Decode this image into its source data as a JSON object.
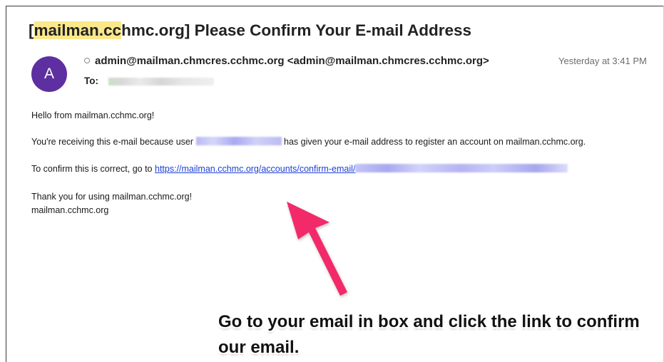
{
  "email": {
    "subject_highlight": "mailman.cc",
    "subject_prefix": "[",
    "subject_rest": "hmc.org] Please Confirm Your E-mail Address",
    "avatar_initial": "A",
    "from": "admin@mailman.chmcres.cchmc.org <admin@mailman.chmcres.cchmc.org>",
    "date": "Yesterday at 3:41 PM",
    "to_label": "To:",
    "body": {
      "greeting": "Hello from mailman.cchmc.org!",
      "line2_before": "You're receiving this e-mail because user",
      "line2_after": "has given your e-mail address to register an account on mailman.cchmc.org.",
      "line3_before": "To confirm this is correct, go to",
      "link_text": "https://mailman.cchmc.org/accounts/confirm-email/",
      "thanks": "Thank you for using mailman.cchmc.org!",
      "signature": "mailman.cchmc.org"
    }
  },
  "annotation": {
    "text": "Go to your email in box and click the link to confirm our email.",
    "arrow_color": "#f22a6a"
  },
  "colors": {
    "avatar": "#5e2fa0",
    "link": "#1a3fd8",
    "highlight": "#fbe88a"
  }
}
